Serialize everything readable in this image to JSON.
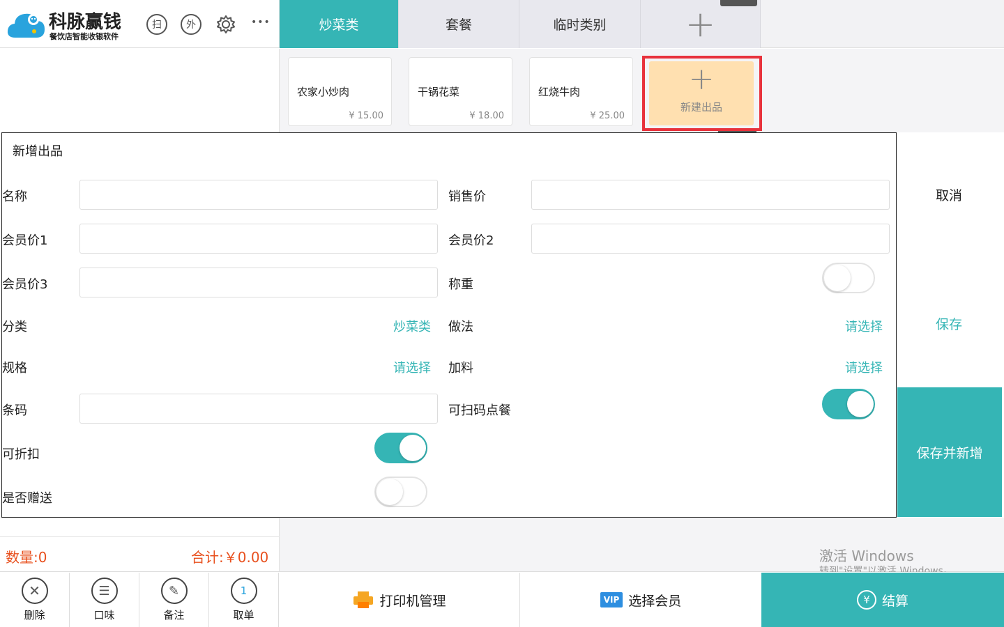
{
  "header": {
    "brand_name": "科脉赢钱",
    "brand_sub": "餐饮店智能收银软件",
    "scan_glyph": "扫",
    "takeout_glyph": "外",
    "more_glyph": "•••"
  },
  "tabs": [
    {
      "label": "炒菜类",
      "active": true
    },
    {
      "label": "套餐",
      "active": false
    },
    {
      "label": "临时类别",
      "active": false
    }
  ],
  "add_tab_glyph": "+",
  "products": [
    {
      "name": "农家小炒肉",
      "price": "¥ 15.00"
    },
    {
      "name": "干锅花菜",
      "price": "¥ 18.00"
    },
    {
      "name": "红烧牛肉",
      "price": "¥ 25.00"
    }
  ],
  "new_product": {
    "plus": "+",
    "label": "新建出品"
  },
  "form": {
    "title": "新增出品",
    "name_label": "名称",
    "price_label": "销售价",
    "member1_label": "会员价1",
    "member2_label": "会员价2",
    "member3_label": "会员价3",
    "weigh_label": "称重",
    "weigh_on": false,
    "category_label": "分类",
    "category_value": "炒菜类",
    "method_label": "做法",
    "method_value": "请选择",
    "spec_label": "规格",
    "spec_value": "请选择",
    "extra_label": "加料",
    "extra_value": "请选择",
    "barcode_label": "条码",
    "scan_order_label": "可扫码点餐",
    "scan_order_on": true,
    "discount_label": "可折扣",
    "discount_on": true,
    "gift_label": "是否赠送",
    "gift_on": false
  },
  "actions": {
    "cancel": "取消",
    "save": "保存",
    "save_new": "保存并新增"
  },
  "summary": {
    "qty": "数量:0",
    "total": "合计:￥0.00"
  },
  "bottom_buttons": [
    {
      "label": "删除",
      "glyph": "✕"
    },
    {
      "label": "口味",
      "glyph": "☰"
    },
    {
      "label": "备注",
      "glyph": "✎"
    },
    {
      "label": "取单",
      "glyph": "1"
    }
  ],
  "printer_label": "打印机管理",
  "member_label": "选择会员",
  "vip_badge": "VIP",
  "checkout_label": "结算",
  "checkout_glyph": "¥",
  "watermark": {
    "line1": "激活 Windows",
    "line2": "转到\"设置\"以激活 Windows。"
  },
  "colors": {
    "accent": "#35b5b5",
    "highlight": "#e8323c",
    "new_card": "#ffe0b0",
    "price_red": "#e8501e"
  }
}
